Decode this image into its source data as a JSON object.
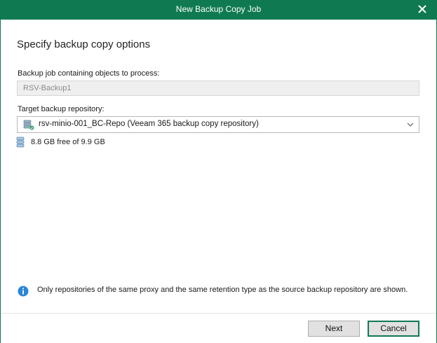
{
  "window": {
    "title": "New Backup Copy Job"
  },
  "header": {
    "heading": "Specify backup copy options"
  },
  "form": {
    "source_label": "Backup job containing objects to process:",
    "source_value": "RSV-Backup1",
    "target_label": "Target backup repository:",
    "target_value": "rsv-minio-001_BC-Repo (Veeam 365 backup copy repository)",
    "free_space": "8.8 GB free of 9.9 GB"
  },
  "info": {
    "text": "Only repositories of the same proxy and the same retention type as the source backup repository are shown."
  },
  "footer": {
    "next_label": "Next",
    "cancel_label": "Cancel"
  },
  "icons": {
    "close": "close-icon",
    "repository": "repository-icon",
    "dropdown": "chevron-down-icon",
    "storage": "database-icon",
    "info": "info-icon"
  },
  "colors": {
    "accent": "#0f7a52",
    "info_blue": "#1e88e5"
  }
}
